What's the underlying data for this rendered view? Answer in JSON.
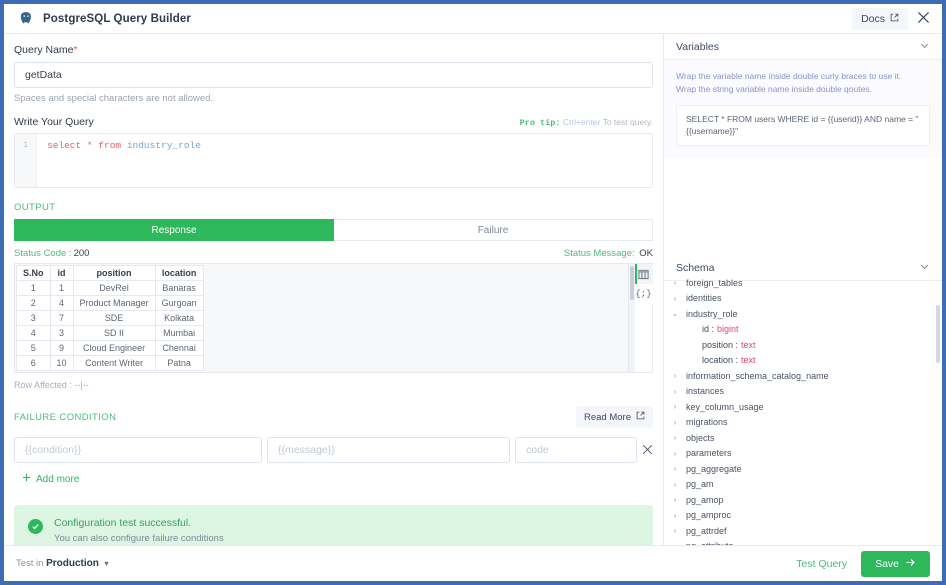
{
  "titlebar": {
    "title": "PostgreSQL Query Builder",
    "logo_icon": "postgresql-elephant-icon",
    "docs_label": "Docs",
    "docs_icon": "external-link-icon",
    "close_icon": "close-icon"
  },
  "query_name": {
    "label": "Query Name",
    "required_marker": "*",
    "value": "getData",
    "placeholder": "",
    "helper": "Spaces and special characters are not allowed."
  },
  "query_editor": {
    "label": "Write Your Query",
    "protip_label": "Pro tip:",
    "protip_key": "Ctrl+enter",
    "protip_rest": "To test query.",
    "line_number": "1",
    "code_keyword": "select * from ",
    "code_identifier": "industry_role"
  },
  "output": {
    "section_title": "OUTPUT",
    "tabs": [
      {
        "label": "Response",
        "active": true
      },
      {
        "label": "Failure",
        "active": false
      }
    ],
    "status_code_label": "Status Code :",
    "status_code_value": "200",
    "status_message_label": "Status Message:",
    "status_message_value": "OK",
    "view_table_icon": "table-view-icon",
    "view_json_icon": "json-view-icon",
    "view_json_glyph": "{;}",
    "rows_affected": "Row Affected : --|--",
    "table": {
      "columns": [
        "S.No",
        "id",
        "position",
        "location"
      ],
      "rows": [
        [
          "1",
          "1",
          "DevRel",
          "Banaras"
        ],
        [
          "2",
          "4",
          "Product Manager",
          "Gurgoan"
        ],
        [
          "3",
          "7",
          "SDE",
          "Kolkata"
        ],
        [
          "4",
          "3",
          "SD II",
          "Mumbai"
        ],
        [
          "5",
          "9",
          "Cloud Engineer",
          "Chennai"
        ],
        [
          "6",
          "10",
          "Content Writer",
          "Patna"
        ]
      ]
    }
  },
  "failure_condition": {
    "title": "FAILURE CONDITION",
    "read_more_label": "Read More",
    "read_more_icon": "external-link-icon",
    "condition_placeholder": "{{condition}}",
    "condition_value": "",
    "message_placeholder": "{{message}}",
    "message_value": "",
    "code_placeholder": "code",
    "code_value": "",
    "remove_icon": "close-icon",
    "add_more_label": "Add more",
    "add_more_icon": "plus-icon"
  },
  "banner": {
    "icon": "check-circle-icon",
    "title": "Configuration test successful.",
    "subtitle": "You can also configure failure conditions"
  },
  "variables": {
    "panel_title": "Variables",
    "chevron_icon": "chevron-down-icon",
    "hint_line1": "Wrap the variable name inside double curly braces to use it.",
    "hint_line2": "Wrap the string variable name inside double qoutes.",
    "example": "SELECT * FROM users WHERE id = {{userid}} AND name = \"{{username}}\""
  },
  "schema": {
    "panel_title": "Schema",
    "chevron_icon": "chevron-down-icon",
    "items": [
      {
        "name": "foreign_tables",
        "expanded": false,
        "columns": []
      },
      {
        "name": "identities",
        "expanded": false,
        "columns": []
      },
      {
        "name": "industry_role",
        "expanded": true,
        "columns": [
          {
            "name": "id",
            "type": "bigint"
          },
          {
            "name": "position",
            "type": "text"
          },
          {
            "name": "location",
            "type": "text"
          }
        ]
      },
      {
        "name": "information_schema_catalog_name",
        "expanded": false,
        "columns": []
      },
      {
        "name": "instances",
        "expanded": false,
        "columns": []
      },
      {
        "name": "key_column_usage",
        "expanded": false,
        "columns": []
      },
      {
        "name": "migrations",
        "expanded": false,
        "columns": []
      },
      {
        "name": "objects",
        "expanded": false,
        "columns": []
      },
      {
        "name": "parameters",
        "expanded": false,
        "columns": []
      },
      {
        "name": "pg_aggregate",
        "expanded": false,
        "columns": []
      },
      {
        "name": "pg_am",
        "expanded": false,
        "columns": []
      },
      {
        "name": "pg_amop",
        "expanded": false,
        "columns": []
      },
      {
        "name": "pg_amproc",
        "expanded": false,
        "columns": []
      },
      {
        "name": "pg_attrdef",
        "expanded": false,
        "columns": []
      },
      {
        "name": "pg_attribute",
        "expanded": false,
        "columns": []
      }
    ]
  },
  "footer": {
    "test_in_prefix": "Test in",
    "environment": "Production",
    "caret_icon": "caret-down-icon",
    "test_query_label": "Test Query",
    "save_label": "Save",
    "save_icon": "arrow-right-icon"
  },
  "colors": {
    "accent_green": "#2eb85c",
    "window_border_blue": "#3c6cb4",
    "type_pink": "#e0457b",
    "required_red": "#f05252"
  }
}
